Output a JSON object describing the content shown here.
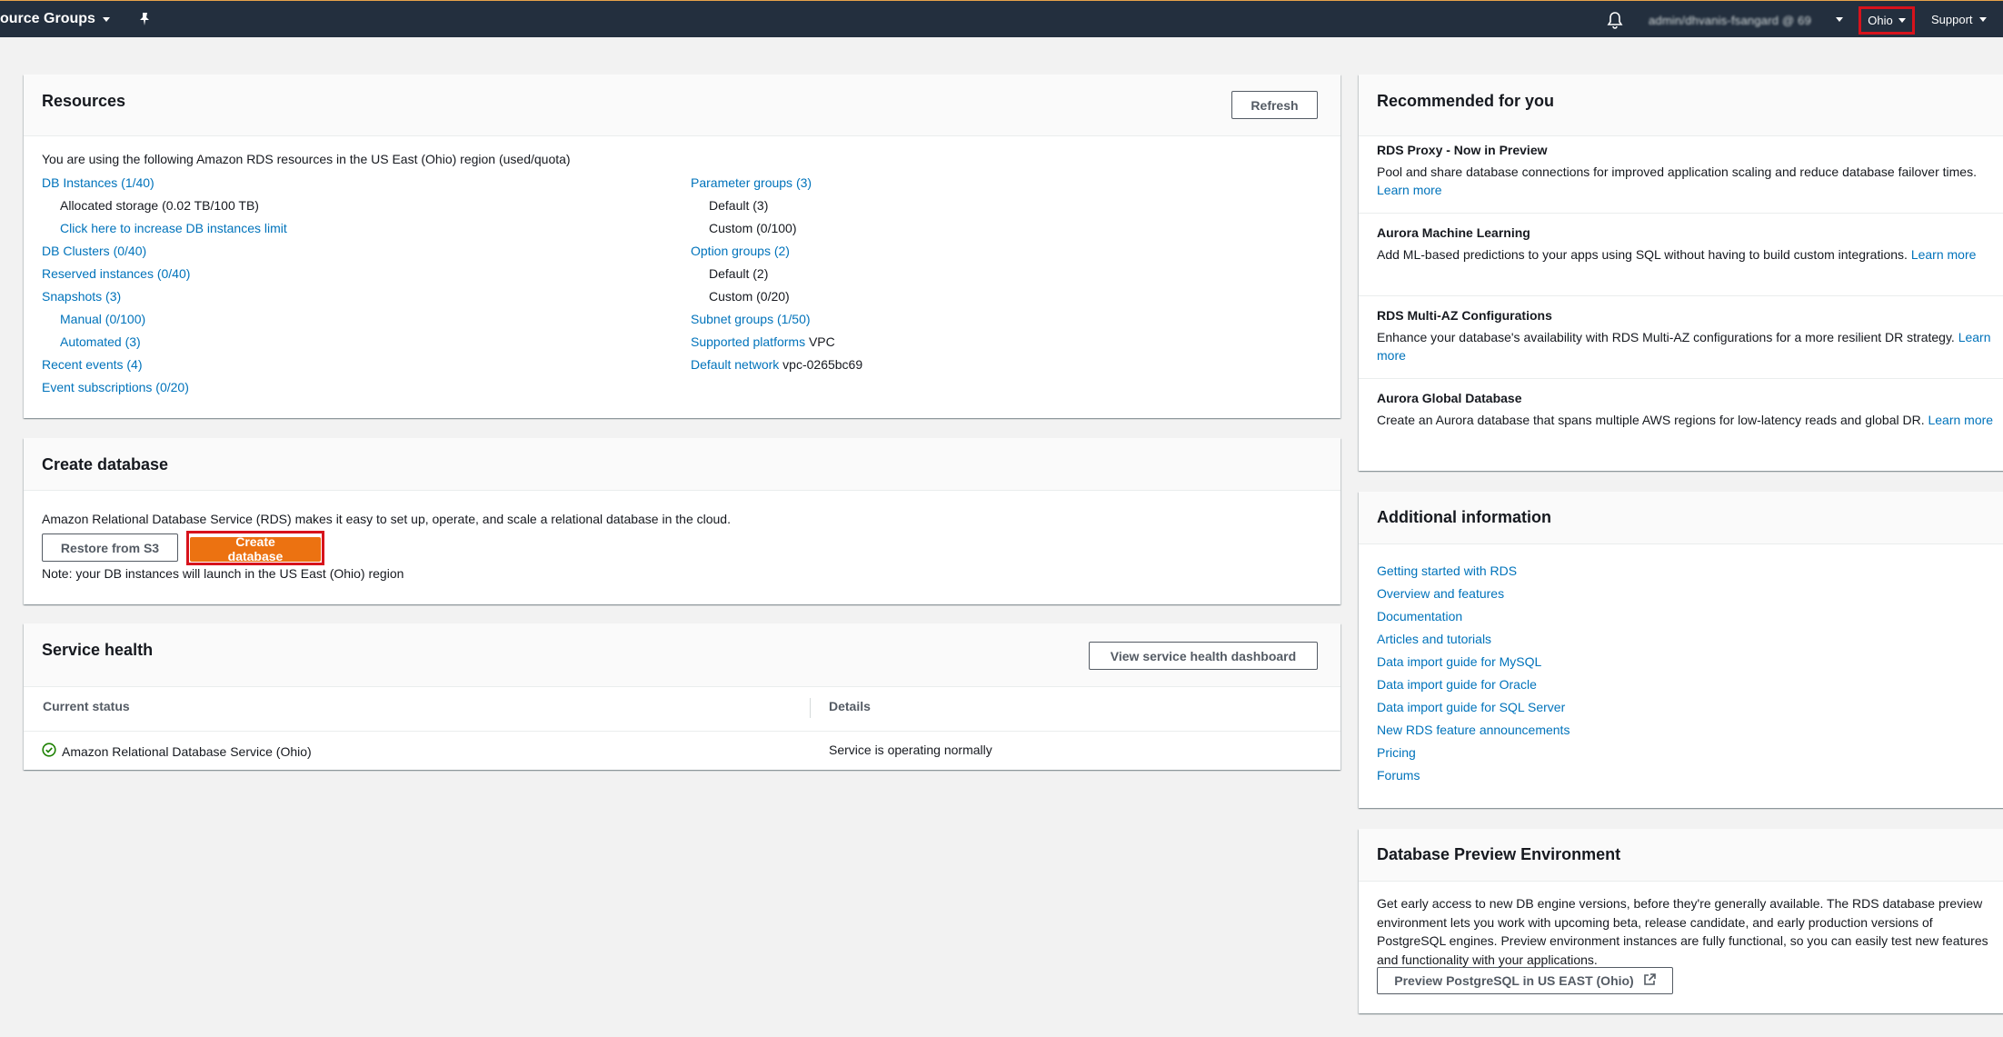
{
  "nav": {
    "resource_groups": "ource Groups",
    "account": "admin/dhvanis-fsangard @ 69",
    "region": "Ohio",
    "support": "Support"
  },
  "resources": {
    "title": "Resources",
    "refresh": "Refresh",
    "intro": "You are using the following Amazon RDS resources in the US East (Ohio) region (used/quota)",
    "left": {
      "db_instances": "DB Instances (1/40)",
      "allocated_storage": "Allocated storage (0.02 TB/100 TB)",
      "increase_limit": "Click here to increase DB instances limit",
      "db_clusters": "DB Clusters (0/40)",
      "reserved": "Reserved instances (0/40)",
      "snapshots": "Snapshots (3)",
      "manual": "Manual (0/100)",
      "automated": "Automated (3)",
      "recent_events": "Recent events (4)",
      "event_subs": "Event subscriptions (0/20)"
    },
    "right": {
      "param_groups": "Parameter groups (3)",
      "param_default": "Default (3)",
      "param_custom": "Custom (0/100)",
      "option_groups": "Option groups (2)",
      "option_default": "Default (2)",
      "option_custom": "Custom (0/20)",
      "subnet_groups": "Subnet groups (1/50)",
      "supported_platforms_label": "Supported platforms",
      "supported_platforms_value": "VPC",
      "default_network_label": "Default network",
      "default_network_value": "vpc-0265bc69"
    }
  },
  "create_db": {
    "title": "Create database",
    "description": "Amazon Relational Database Service (RDS) makes it easy to set up, operate, and scale a relational database in the cloud.",
    "restore": "Restore from S3",
    "create": "Create database",
    "note": "Note: your DB instances will launch in the US East (Ohio) region"
  },
  "health": {
    "title": "Service health",
    "view_dashboard": "View service health dashboard",
    "col_status": "Current status",
    "col_details": "Details",
    "row_service": "Amazon Relational Database Service (Ohio)",
    "row_details": "Service is operating normally",
    "status_color": "#1d8102"
  },
  "recommended": {
    "title": "Recommended for you",
    "items": [
      {
        "title": "RDS Proxy - Now in Preview",
        "text": "Pool and share database connections for improved application scaling and reduce database failover times.",
        "link": "Learn more"
      },
      {
        "title": "Aurora Machine Learning",
        "text": "Add ML-based predictions to your apps using SQL without having to build custom integrations.",
        "link": "Learn more"
      },
      {
        "title": "RDS Multi-AZ Configurations",
        "text": "Enhance your database's availability with RDS Multi-AZ configurations for a more resilient DR strategy.",
        "link": "Learn more"
      },
      {
        "title": "Aurora Global Database",
        "text": "Create an Aurora database that spans multiple AWS regions for low-latency reads and global DR.",
        "link": "Learn more"
      }
    ]
  },
  "additional": {
    "title": "Additional information",
    "links": [
      "Getting started with RDS",
      "Overview and features",
      "Documentation",
      "Articles and tutorials",
      "Data import guide for MySQL",
      "Data import guide for Oracle",
      "Data import guide for SQL Server",
      "New RDS feature announcements",
      "Pricing",
      "Forums"
    ]
  },
  "preview": {
    "title": "Database Preview Environment",
    "text": "Get early access to new DB engine versions, before they're generally available. The RDS database preview environment lets you work with upcoming beta, release candidate, and early production versions of PostgreSQL engines. Preview environment instances are fully functional, so you can easily test new features and functionality with your applications.",
    "button": "Preview PostgreSQL in US EAST (Ohio)"
  },
  "colors": {
    "nav_bg": "#232f3e",
    "link": "#0073bb",
    "primary": "#ec7211",
    "highlight": "#d7131c"
  }
}
